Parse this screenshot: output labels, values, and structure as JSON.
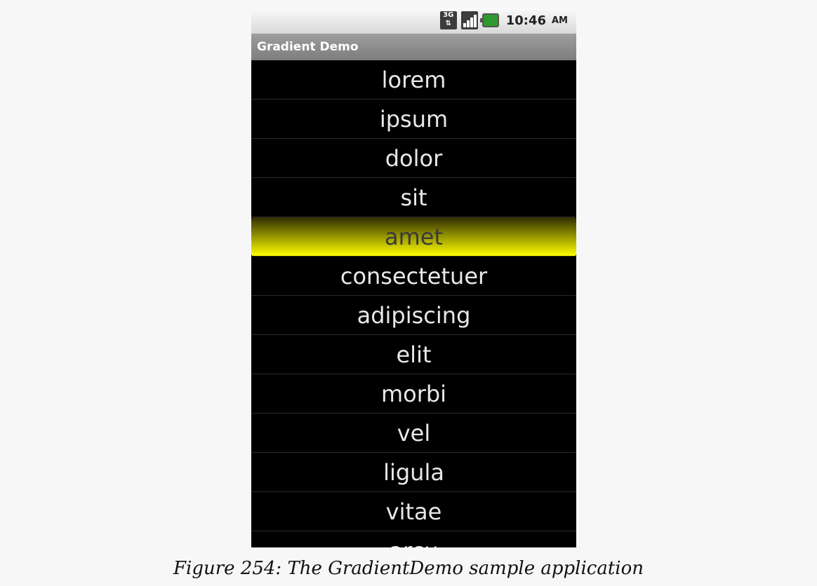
{
  "status_bar": {
    "network_label": "3G",
    "time": "10:46",
    "ampm": "AM"
  },
  "app": {
    "title": "Gradient Demo"
  },
  "list": {
    "items": [
      "lorem",
      "ipsum",
      "dolor",
      "sit",
      "amet",
      "consectetuer",
      "adipiscing",
      "elit",
      "morbi",
      "vel",
      "ligula",
      "vitae",
      "arcu"
    ],
    "selected_index": 4,
    "selected_gradient_colors": [
      "#302e00",
      "#ffff00"
    ]
  },
  "caption": "Figure 254: The GradientDemo sample application"
}
